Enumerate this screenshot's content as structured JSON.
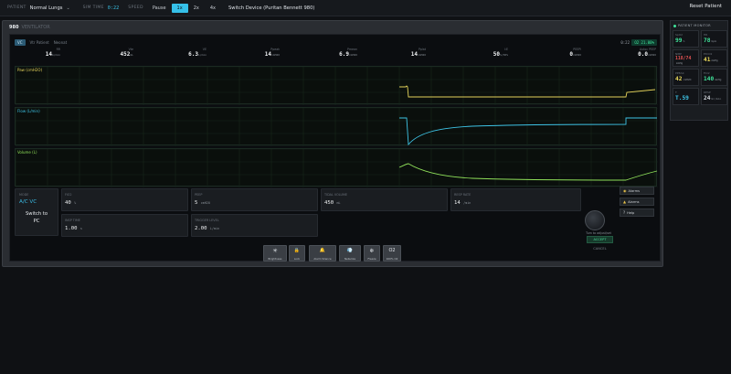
{
  "topbar": {
    "patient_label": "PATIENT",
    "patient_value": "Normal Lungs",
    "sim_time_label": "SIM TIME",
    "sim_time_value": "0:22",
    "speed_label": "SPEED",
    "pause_label": "Pause",
    "speeds": [
      "1x",
      "2x",
      "4x"
    ],
    "active_speed": "1x",
    "switch_device": "Switch Device (Puritan Bennett 980)",
    "reset_patient": "Reset Patient"
  },
  "vent": {
    "title": "980",
    "subtitle": "VENTILATOR",
    "header": {
      "mode_chip": "VC",
      "patient_text": "Vtr Patient",
      "neonate_text": "Neonat",
      "time": "0:22",
      "o2_badge": "O2 21.00%"
    },
    "params": [
      {
        "label": "RR",
        "value": "14",
        "unit": "b/min"
      },
      {
        "label": "Vte",
        "value": "452",
        "unit": "mL"
      },
      {
        "label": "VE",
        "value": "6.3",
        "unit": "L/min"
      },
      {
        "label": "Ppeak",
        "value": "14",
        "unit": "cmH2O"
      },
      {
        "label": "Pmean",
        "value": "6.9",
        "unit": "cmH2O"
      },
      {
        "label": "Pplat",
        "value": "14",
        "unit": "cmH2O"
      },
      {
        "label": "I:E",
        "value": "50",
        "unit": "%/50%"
      },
      {
        "label": "PEEPi",
        "value": "0",
        "unit": "cmH2O"
      },
      {
        "label": "Autoc PEEP",
        "value": "0.0",
        "unit": "cmH2O"
      }
    ],
    "waves": [
      {
        "label": "Paw (cmH2O)",
        "color": "#e3d25a"
      },
      {
        "label": "Flow (L/min)",
        "color": "#3ec4e6"
      },
      {
        "label": "Volume (L)",
        "color": "#8fe05a"
      }
    ],
    "mode_card": {
      "label": "MODE",
      "mode": "A/C VC",
      "switch_line1": "Switch to",
      "switch_line2": "PC"
    },
    "settings": [
      {
        "label": "FiO2",
        "value": "40",
        "unit": "%"
      },
      {
        "label": "PEEP",
        "value": "5",
        "unit": "cmH2O"
      },
      {
        "label": "TIDAL VOLUME",
        "value": "450",
        "unit": "mL"
      },
      {
        "label": "RESP RATE",
        "value": "14",
        "unit": "/min"
      },
      {
        "label": "INSP TIME",
        "value": "1.00",
        "unit": "s"
      },
      {
        "label": "TRIGGER LEVEL",
        "value": "2.00",
        "unit": "L/min"
      }
    ],
    "knob_label": "Turn to adjust/set",
    "accept": "ACCEPT",
    "cancel": "CANCEL",
    "side_buttons": [
      "Alarms",
      "Alarms",
      "Help"
    ],
    "side_icons": [
      "bell-icon",
      "warning-icon",
      "help-icon"
    ]
  },
  "toolbar": [
    {
      "icon": "✳",
      "label": "Brightness",
      "name": "brightness-icon"
    },
    {
      "icon": "🔒",
      "label": "Lock",
      "name": "lock-icon"
    },
    {
      "icon": "🔔",
      "label": "Alarm Silence",
      "name": "alarm-silence-icon"
    },
    {
      "icon": "💨",
      "label": "Nebulize",
      "name": "nebulize-icon"
    },
    {
      "icon": "❄",
      "label": "Freeze",
      "name": "freeze-icon"
    },
    {
      "icon": "O2",
      "label": "100% O2",
      "name": "o2-icon"
    }
  ],
  "monitor": {
    "title": "PATIENT MONITOR",
    "vitals": [
      {
        "label": "SpO2",
        "value": "99",
        "unit": "%",
        "color": "#3fe39a"
      },
      {
        "label": "HR",
        "value": "78",
        "unit": "bpm",
        "color": "#3fe39a"
      },
      {
        "label": "NIBP",
        "value": "118/74",
        "unit": "mmHg",
        "color": "#e85454"
      },
      {
        "label": "EtCO2",
        "value": "41",
        "unit": "mmHg",
        "color": "#e8d85a"
      },
      {
        "label": "PPEAK",
        "value": "42",
        "unit": "cmH2O",
        "color": "#e8d85a"
      },
      {
        "label": "FiO2",
        "value": "140",
        "unit": "mmHg",
        "color": "#3fe39a"
      },
      {
        "label": "T",
        "value": "T.59",
        "unit": "",
        "color": "#3ec4e6"
      },
      {
        "label": "RESP",
        "value": "24",
        "unit": "br/min",
        "color": "#cfd3d8"
      }
    ]
  }
}
